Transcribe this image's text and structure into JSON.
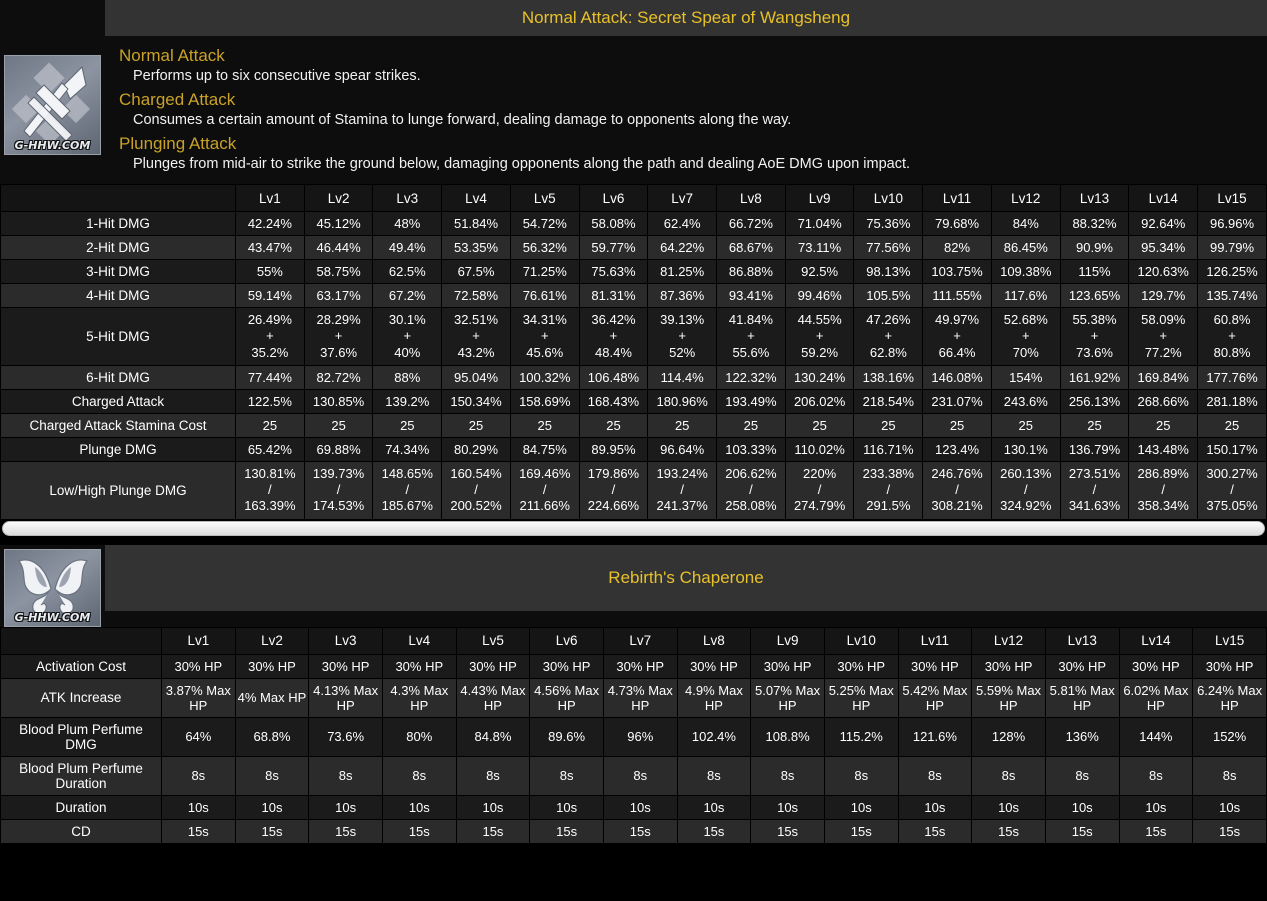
{
  "watermark": "G-HHW.COM",
  "colors": {
    "title_gold": "#e8c12a",
    "heading_gold": "#c9a227",
    "title_bar_bg": "#333333"
  },
  "talent": {
    "icon_name": "polearm-normal-attack-icon",
    "title": "Normal Attack: Secret Spear of Wangsheng",
    "sections": [
      {
        "heading": "Normal Attack",
        "text": "Performs up to six consecutive spear strikes."
      },
      {
        "heading": "Charged Attack",
        "text": "Consumes a certain amount of Stamina to lunge forward, dealing damage to opponents along the way."
      },
      {
        "heading": "Plunging Attack",
        "text": "Plunges from mid-air to strike the ground below, damaging opponents along the path and dealing AoE DMG upon impact."
      }
    ],
    "table": {
      "corner": "",
      "columns": [
        "Lv1",
        "Lv2",
        "Lv3",
        "Lv4",
        "Lv5",
        "Lv6",
        "Lv7",
        "Lv8",
        "Lv9",
        "Lv10",
        "Lv11",
        "Lv12",
        "Lv13",
        "Lv14",
        "Lv15"
      ],
      "rows": [
        {
          "label": "1-Hit DMG",
          "values": [
            "42.24%",
            "45.12%",
            "48%",
            "51.84%",
            "54.72%",
            "58.08%",
            "62.4%",
            "66.72%",
            "71.04%",
            "75.36%",
            "79.68%",
            "84%",
            "88.32%",
            "92.64%",
            "96.96%"
          ]
        },
        {
          "label": "2-Hit DMG",
          "values": [
            "43.47%",
            "46.44%",
            "49.4%",
            "53.35%",
            "56.32%",
            "59.77%",
            "64.22%",
            "68.67%",
            "73.11%",
            "77.56%",
            "82%",
            "86.45%",
            "90.9%",
            "95.34%",
            "99.79%"
          ]
        },
        {
          "label": "3-Hit DMG",
          "values": [
            "55%",
            "58.75%",
            "62.5%",
            "67.5%",
            "71.25%",
            "75.63%",
            "81.25%",
            "86.88%",
            "92.5%",
            "98.13%",
            "103.75%",
            "109.38%",
            "115%",
            "120.63%",
            "126.25%"
          ]
        },
        {
          "label": "4-Hit DMG",
          "values": [
            "59.14%",
            "63.17%",
            "67.2%",
            "72.58%",
            "76.61%",
            "81.31%",
            "87.36%",
            "93.41%",
            "99.46%",
            "105.5%",
            "111.55%",
            "117.6%",
            "123.65%",
            "129.7%",
            "135.74%"
          ]
        },
        {
          "label": "5-Hit DMG",
          "values": [
            "26.49%\n+\n35.2%",
            "28.29%\n+\n37.6%",
            "30.1%\n+\n40%",
            "32.51%\n+\n43.2%",
            "34.31%\n+\n45.6%",
            "36.42%\n+\n48.4%",
            "39.13%\n+\n52%",
            "41.84%\n+\n55.6%",
            "44.55%\n+\n59.2%",
            "47.26%\n+\n62.8%",
            "49.97%\n+\n66.4%",
            "52.68%\n+\n70%",
            "55.38%\n+\n73.6%",
            "58.09%\n+\n77.2%",
            "60.8%\n+\n80.8%"
          ]
        },
        {
          "label": "6-Hit DMG",
          "values": [
            "77.44%",
            "82.72%",
            "88%",
            "95.04%",
            "100.32%",
            "106.48%",
            "114.4%",
            "122.32%",
            "130.24%",
            "138.16%",
            "146.08%",
            "154%",
            "161.92%",
            "169.84%",
            "177.76%"
          ]
        },
        {
          "label": "Charged Attack",
          "values": [
            "122.5%",
            "130.85%",
            "139.2%",
            "150.34%",
            "158.69%",
            "168.43%",
            "180.96%",
            "193.49%",
            "206.02%",
            "218.54%",
            "231.07%",
            "243.6%",
            "256.13%",
            "268.66%",
            "281.18%"
          ]
        },
        {
          "label": "Charged Attack Stamina Cost",
          "values": [
            "25",
            "25",
            "25",
            "25",
            "25",
            "25",
            "25",
            "25",
            "25",
            "25",
            "25",
            "25",
            "25",
            "25",
            "25"
          ]
        },
        {
          "label": "Plunge DMG",
          "values": [
            "65.42%",
            "69.88%",
            "74.34%",
            "80.29%",
            "84.75%",
            "89.95%",
            "96.64%",
            "103.33%",
            "110.02%",
            "116.71%",
            "123.4%",
            "130.1%",
            "136.79%",
            "143.48%",
            "150.17%"
          ]
        },
        {
          "label": "Low/High Plunge DMG",
          "values": [
            "130.81%\n/\n163.39%",
            "139.73%\n/\n174.53%",
            "148.65%\n/\n185.67%",
            "160.54%\n/\n200.52%",
            "169.46%\n/\n211.66%",
            "179.86%\n/\n224.66%",
            "193.24%\n/\n241.37%",
            "206.62%\n/\n258.08%",
            "220%\n/\n274.79%",
            "233.38%\n/\n291.5%",
            "246.76%\n/\n308.21%",
            "260.13%\n/\n324.92%",
            "273.51%\n/\n341.63%",
            "286.89%\n/\n358.34%",
            "300.27%\n/\n375.05%"
          ]
        }
      ]
    }
  },
  "weapon": {
    "icon_name": "butterfly-wings-icon",
    "title": "Rebirth's Chaperone",
    "table": {
      "corner": "",
      "columns": [
        "Lv1",
        "Lv2",
        "Lv3",
        "Lv4",
        "Lv5",
        "Lv6",
        "Lv7",
        "Lv8",
        "Lv9",
        "Lv10",
        "Lv11",
        "Lv12",
        "Lv13",
        "Lv14",
        "Lv15"
      ],
      "rows": [
        {
          "label": "Activation Cost",
          "values": [
            "30% HP",
            "30% HP",
            "30% HP",
            "30% HP",
            "30% HP",
            "30% HP",
            "30% HP",
            "30% HP",
            "30% HP",
            "30% HP",
            "30% HP",
            "30% HP",
            "30% HP",
            "30% HP",
            "30% HP"
          ]
        },
        {
          "label": "ATK Increase",
          "values": [
            "3.87% Max HP",
            "4% Max HP",
            "4.13% Max HP",
            "4.3% Max HP",
            "4.43% Max HP",
            "4.56% Max HP",
            "4.73% Max HP",
            "4.9% Max HP",
            "5.07% Max HP",
            "5.25% Max HP",
            "5.42% Max HP",
            "5.59% Max HP",
            "5.81% Max HP",
            "6.02% Max HP",
            "6.24% Max HP"
          ]
        },
        {
          "label": "Blood Plum Perfume DMG",
          "values": [
            "64%",
            "68.8%",
            "73.6%",
            "80%",
            "84.8%",
            "89.6%",
            "96%",
            "102.4%",
            "108.8%",
            "115.2%",
            "121.6%",
            "128%",
            "136%",
            "144%",
            "152%"
          ]
        },
        {
          "label": "Blood Plum Perfume Duration",
          "values": [
            "8s",
            "8s",
            "8s",
            "8s",
            "8s",
            "8s",
            "8s",
            "8s",
            "8s",
            "8s",
            "8s",
            "8s",
            "8s",
            "8s",
            "8s"
          ]
        },
        {
          "label": "Duration",
          "values": [
            "10s",
            "10s",
            "10s",
            "10s",
            "10s",
            "10s",
            "10s",
            "10s",
            "10s",
            "10s",
            "10s",
            "10s",
            "10s",
            "10s",
            "10s"
          ]
        },
        {
          "label": "CD",
          "values": [
            "15s",
            "15s",
            "15s",
            "15s",
            "15s",
            "15s",
            "15s",
            "15s",
            "15s",
            "15s",
            "15s",
            "15s",
            "15s",
            "15s",
            "15s"
          ]
        }
      ]
    }
  }
}
